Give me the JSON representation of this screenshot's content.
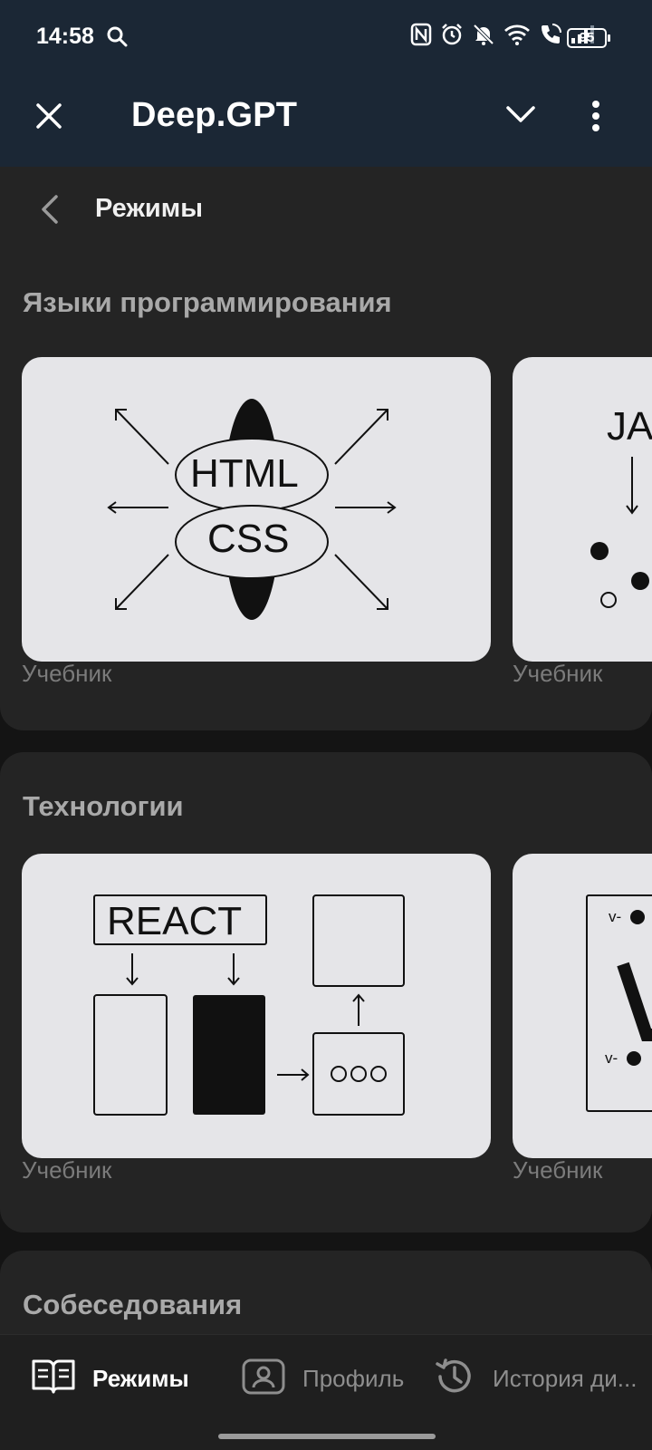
{
  "status": {
    "time": "14:58",
    "battery": "95",
    "icons": [
      "search-icon",
      "nfc-icon",
      "alarm-icon",
      "mute-icon",
      "wifi-icon",
      "wifi-call-icon",
      "signal-icon"
    ]
  },
  "appbar": {
    "title": "Deep.GPT",
    "close_icon": "close-icon",
    "dropdown_icon": "chevron-down-icon",
    "more_icon": "more-vertical-icon"
  },
  "page": {
    "title": "Режимы"
  },
  "sections": [
    {
      "title": "Языки программирования",
      "cards": [
        {
          "art": [
            "HTML",
            "CSS"
          ],
          "label": "Учебник"
        },
        {
          "art": [
            "JA"
          ],
          "label": "Учебник"
        }
      ]
    },
    {
      "title": "Технологии",
      "cards": [
        {
          "art": [
            "REACT"
          ],
          "label": "Учебник"
        },
        {
          "art": [
            "v-",
            "v-"
          ],
          "label": "Учебник"
        }
      ]
    },
    {
      "title": "Собеседования"
    }
  ],
  "bottom_nav": [
    {
      "label": "Режимы",
      "icon": "book-icon",
      "active": true
    },
    {
      "label": "Профиль",
      "icon": "profile-icon",
      "active": false
    },
    {
      "label": "История ди...",
      "icon": "history-icon",
      "active": false
    }
  ],
  "colors": {
    "header_bg": "#1b2735",
    "section_bg": "#242424",
    "card_bg": "#e5e5e8",
    "muted_text": "#a9a9a9"
  }
}
